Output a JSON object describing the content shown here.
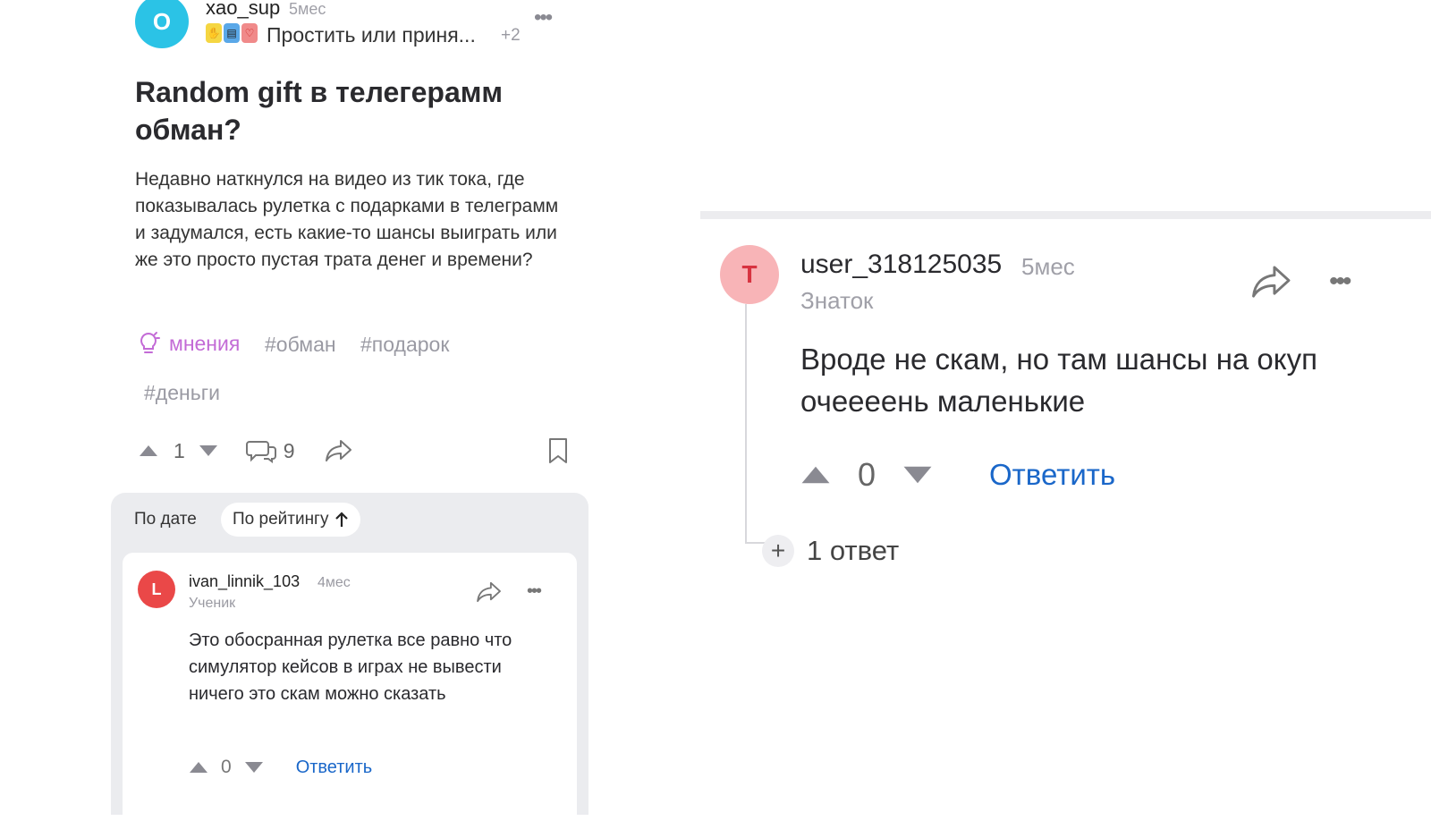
{
  "post": {
    "author_initial": "O",
    "author": "xao_sup",
    "time": "5мес",
    "subject": "Простить или приня...",
    "subject_more": "+2",
    "title": "Random gift в телегерамм обман?",
    "body": "Недавно наткнулся на видео из тик тока, где показывалась рулетка с подарками в телеграмм и задумался, есть какие-то шансы выиграть или же это просто пустая трата денег и времени?",
    "tags": {
      "opinion": "мнения",
      "items": [
        "#обман",
        "#подарок",
        "#деньги"
      ]
    },
    "votes": "1",
    "comments_count": "9"
  },
  "sort": {
    "by_date": "По дате",
    "by_rating": "По рейтингу"
  },
  "comment": {
    "avatar_initial": "L",
    "author": "ivan_linnik_103",
    "time": "4мес",
    "rank": "Ученик",
    "text": "Это обосранная рулетка все равно что симулятор кейсов в играх не вывести ничего это скам можно сказать",
    "votes": "0",
    "reply": "Ответить"
  },
  "zoom_comment": {
    "avatar_initial": "T",
    "author": "user_318125035",
    "time": "5мес",
    "rank": "Знаток",
    "text": "Вроде не скам, но там шансы на окуп очеееень маленькие",
    "votes": "0",
    "reply": "Ответить",
    "replies": "1 ответ"
  },
  "colors": {
    "accent_blue": "#1a67c9",
    "opinion_purple": "#c36bd6",
    "avatar_cyan": "#2bc3e6",
    "avatar_red": "#ea4848",
    "avatar_pink": "#f8b4b7"
  }
}
